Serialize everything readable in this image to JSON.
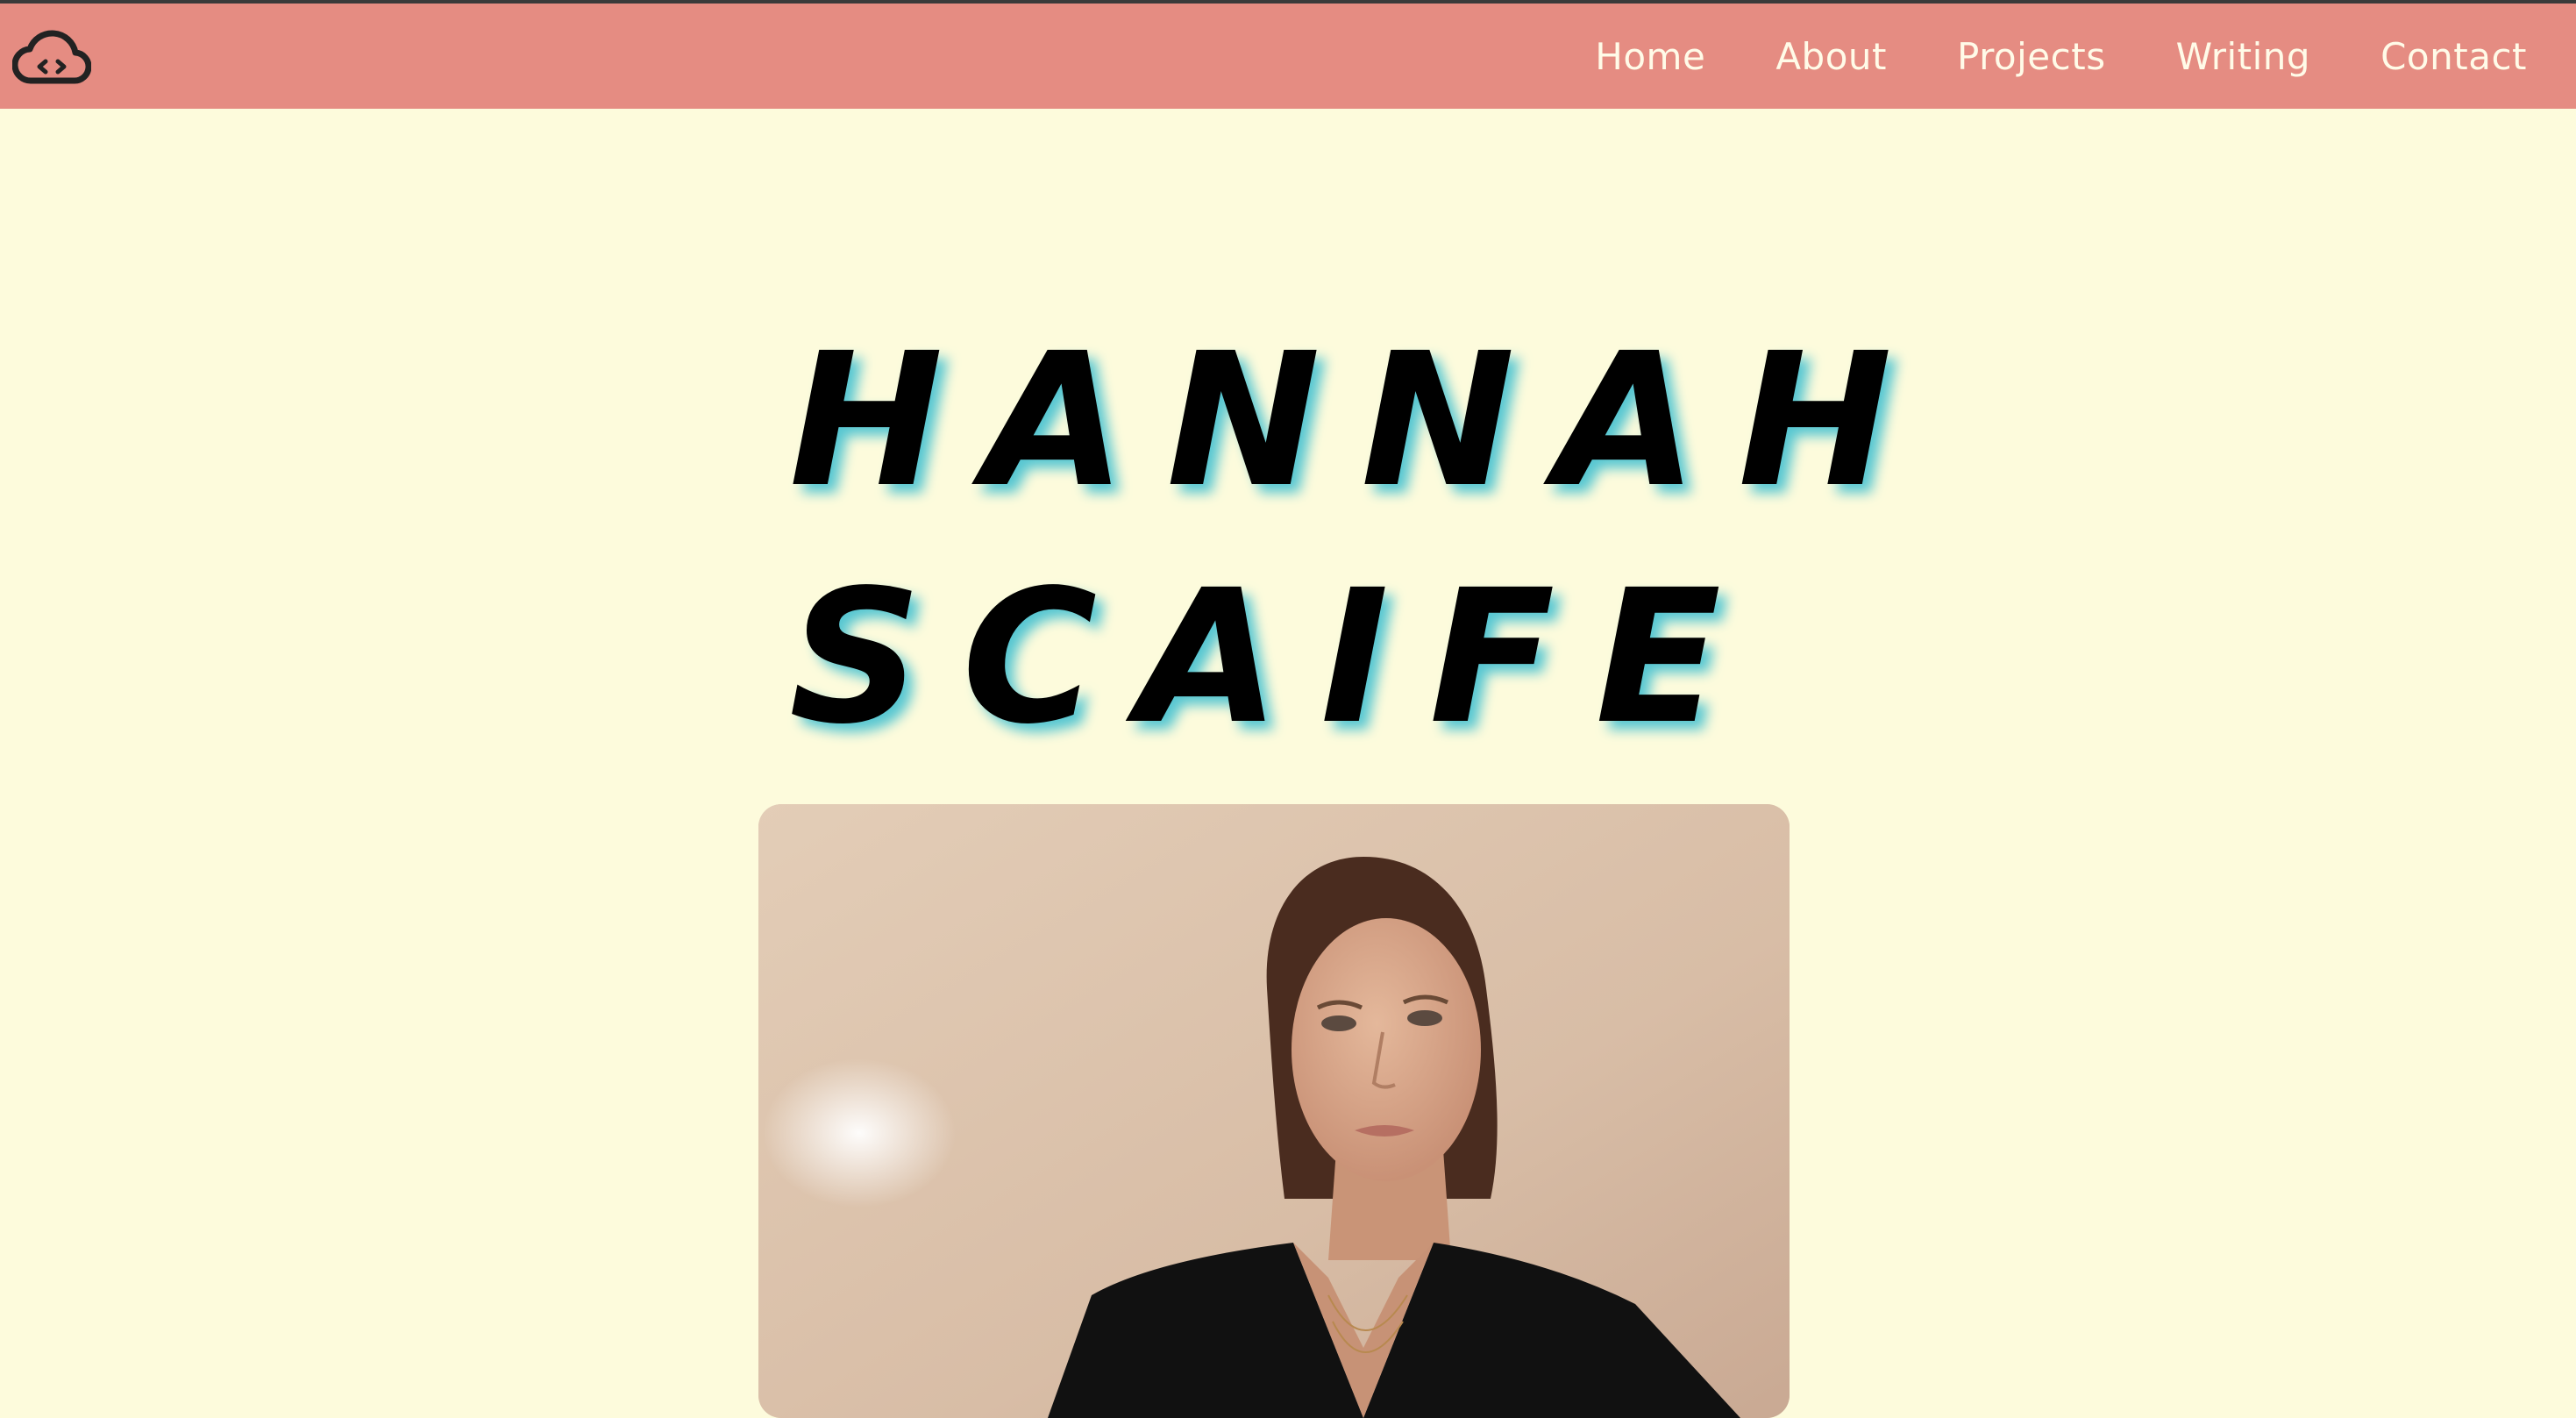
{
  "nav": {
    "logo_icon": "cloud-code-icon",
    "links": [
      "Home",
      "About",
      "Projects",
      "Writing",
      "Contact"
    ]
  },
  "hero": {
    "first_name": "HANNAH",
    "last_name": "SCAIFE",
    "photo_description": "portrait-photo"
  },
  "colors": {
    "navbar": "#e58c82",
    "background": "#fdfbdc",
    "title": "#000000",
    "title_shadow": "#58c7d2",
    "nav_text": "#fffbe8"
  }
}
